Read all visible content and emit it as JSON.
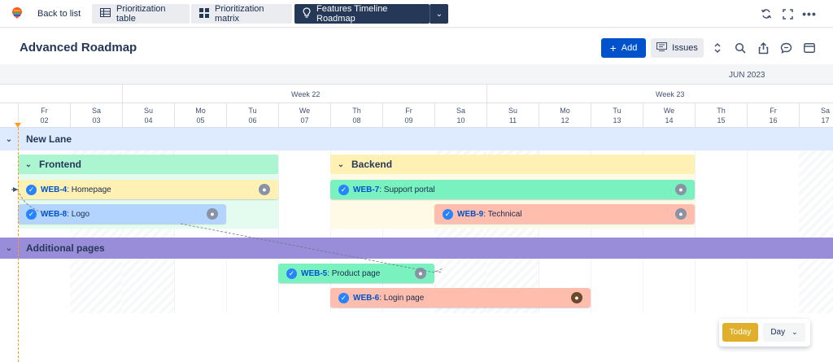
{
  "nav": {
    "back_label": "Back to list",
    "tabs": [
      {
        "label": "Prioritization table",
        "icon": "table-icon"
      },
      {
        "label": "Prioritization matrix",
        "icon": "matrix-icon"
      },
      {
        "label": "Features Timeline Roadmap",
        "icon": "lightbulb-icon"
      }
    ]
  },
  "header": {
    "title": "Advanced Roadmap",
    "add_label": "Add",
    "issues_label": "Issues"
  },
  "timeline": {
    "month": "JUN 2023",
    "weeks": [
      "Week 22",
      "Week 23"
    ],
    "days": [
      {
        "dow": "Fr",
        "date": "02"
      },
      {
        "dow": "Sa",
        "date": "03"
      },
      {
        "dow": "Su",
        "date": "04"
      },
      {
        "dow": "Mo",
        "date": "05"
      },
      {
        "dow": "Tu",
        "date": "06"
      },
      {
        "dow": "We",
        "date": "07"
      },
      {
        "dow": "Th",
        "date": "08"
      },
      {
        "dow": "Fr",
        "date": "09"
      },
      {
        "dow": "Sa",
        "date": "10"
      },
      {
        "dow": "Su",
        "date": "11"
      },
      {
        "dow": "Mo",
        "date": "12"
      },
      {
        "dow": "Tu",
        "date": "13"
      },
      {
        "dow": "We",
        "date": "14"
      },
      {
        "dow": "Th",
        "date": "15"
      },
      {
        "dow": "Fr",
        "date": "16"
      },
      {
        "dow": "Sa",
        "date": "17"
      }
    ]
  },
  "lanes": [
    {
      "name": "New Lane",
      "color": "#deebff"
    },
    {
      "name": "Additional pages",
      "color": "#998dd9"
    }
  ],
  "groups": [
    {
      "name": "Frontend",
      "color": "#abf5d1"
    },
    {
      "name": "Backend",
      "color": "#fff0b3"
    }
  ],
  "cards": [
    {
      "key": "WEB-4",
      "title": "Homepage",
      "color": "#fff0b3"
    },
    {
      "key": "WEB-8",
      "title": "Logo",
      "color": "#b3d4ff"
    },
    {
      "key": "WEB-7",
      "title": "Support portal",
      "color": "#79f2c0"
    },
    {
      "key": "WEB-9",
      "title": "Technical",
      "color": "#ffbdad"
    },
    {
      "key": "WEB-5",
      "title": "Product page",
      "color": "#79f2c0"
    },
    {
      "key": "WEB-6",
      "title": "Login page",
      "color": "#ffbdad"
    }
  ],
  "controls": {
    "today_label": "Today",
    "scale_label": "Day"
  }
}
